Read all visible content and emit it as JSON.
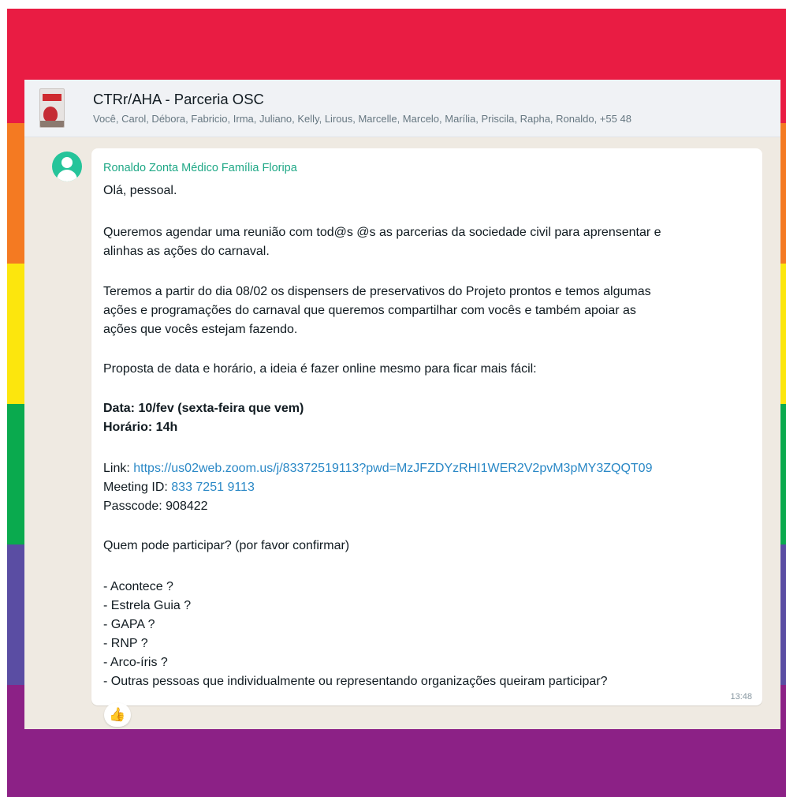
{
  "colors": {
    "stripes": [
      "#e91c43",
      "#f47a22",
      "#fce60d",
      "#0aaa4e",
      "#5a4da3",
      "#8c2186"
    ],
    "chat_background": "#efeae2",
    "header_background": "#f0f2f5",
    "sender_name": "#1fa886",
    "link": "#2a88c6"
  },
  "chat": {
    "title": "CTRr/AHA - Parceria OSC",
    "members": "Você, Carol, Débora, Fabricio, Irma, Juliano, Kelly, Lirous, Marcelle, Marcelo, Marília, Priscila, Rapha, Ronaldo, +55 48"
  },
  "message": {
    "sender": "Ronaldo Zonta Médico Família Floripa",
    "greeting": "Olá, pessoal.",
    "p1_l1": "Queremos agendar uma reunião com tod@s @s as parcerias da sociedade civil para aprensentar e",
    "p1_l2": "alinhas as ações do carnaval.",
    "p2_l1": "Teremos a partir do dia 08/02 os dispensers de preservativos do Projeto prontos e temos algumas",
    "p2_l2": "ações e programações do carnaval que queremos compartilhar com vocês e também apoiar as",
    "p2_l3": "ações que vocês estejam fazendo.",
    "p3": "Proposta de data e horário, a ideia é fazer online mesmo para ficar mais fácil:",
    "date": "Data: 10/fev (sexta-feira que vem)",
    "time": "Horário: 14h",
    "link_label": "Link: ",
    "link_url": "https://us02web.zoom.us/j/83372519113?pwd=MzJFZDYzRHI1WER2V2pvM3pMY3ZQQT09",
    "meeting_id_label": "Meeting ID: ",
    "meeting_id": "833 7251 9113",
    "passcode": "Passcode: 908422",
    "question": "Quem pode participar? (por favor confirmar)",
    "orgs": [
      "- Acontece ?",
      "- Estrela Guia ?",
      "- GAPA ?",
      "- RNP ?",
      "- Arco-íris ?",
      "- Outras pessoas que individualmente ou representando organizações queiram participar?"
    ],
    "timestamp": "13:48",
    "reaction": "👍"
  }
}
